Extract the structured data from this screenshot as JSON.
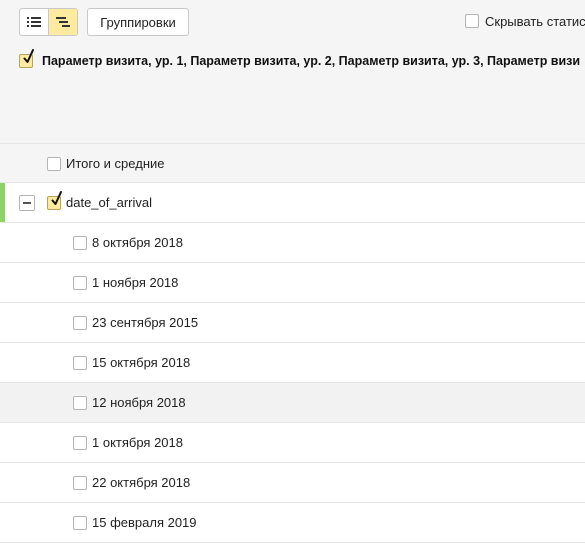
{
  "toolbar": {
    "view_toggle": [
      {
        "icon": "list-icon",
        "active": false
      },
      {
        "icon": "tree-icon",
        "active": true
      }
    ],
    "groupings_label": "Группировки",
    "hide_stats_label": "Скрывать статис",
    "hide_stats_checked": false
  },
  "grouping": {
    "checked": true,
    "text": "Параметр визита, ур. 1, Параметр визита, ур. 2, Параметр визита, ур. 3, Параметр визи"
  },
  "table": {
    "totals_label": "Итого и средние",
    "totals_checked": false,
    "group": {
      "label": "date_of_arrival",
      "checked": true,
      "expanded": true
    },
    "rows": [
      {
        "label": "8 октября 2018",
        "checked": false
      },
      {
        "label": "1 ноября 2018",
        "checked": false
      },
      {
        "label": "23 сентября 2015",
        "checked": false
      },
      {
        "label": "15 октября 2018",
        "checked": false
      },
      {
        "label": "12 ноября 2018",
        "checked": false
      },
      {
        "label": "1 октября 2018",
        "checked": false
      },
      {
        "label": "22 октября 2018",
        "checked": false
      },
      {
        "label": "15 февраля 2019",
        "checked": false
      }
    ]
  },
  "colors": {
    "accent_yellow": "#ffeba0",
    "selected_bar_green": "#8fd16b",
    "header_bg": "#f5f5f5"
  }
}
